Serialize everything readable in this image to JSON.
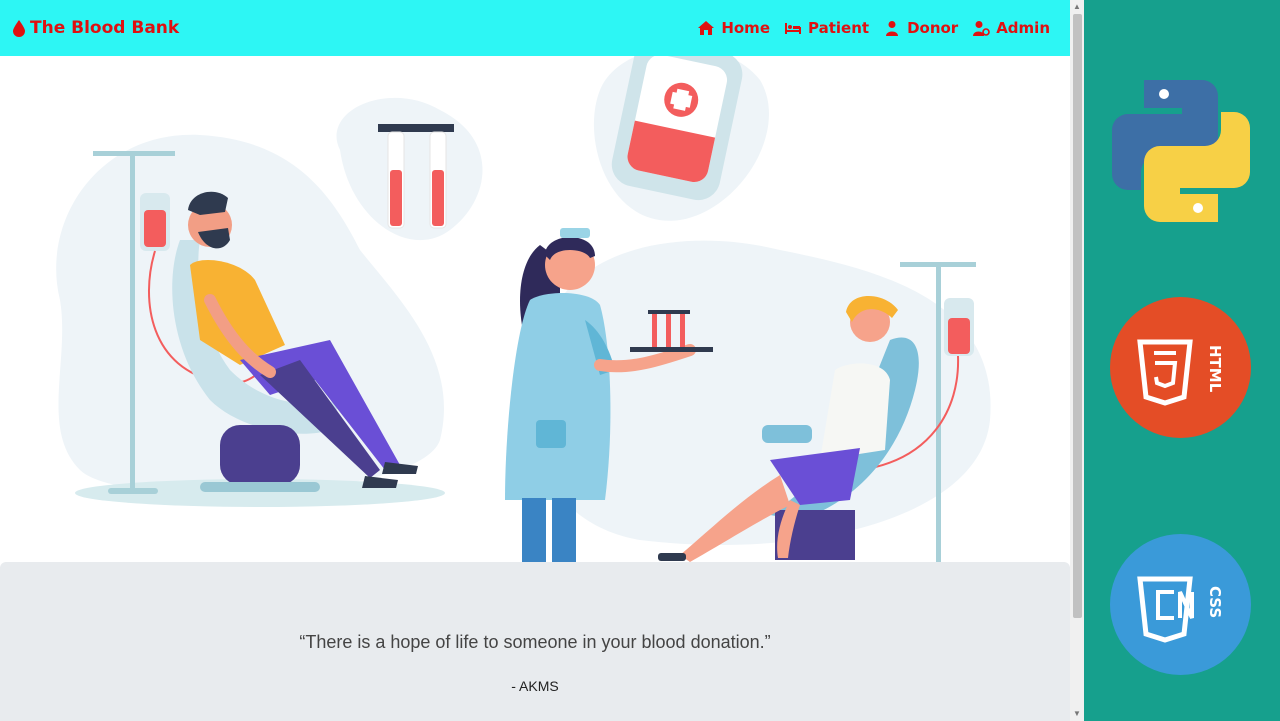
{
  "navbar": {
    "brand": "The Blood Bank",
    "links": [
      {
        "label": "Home",
        "icon": "home-icon"
      },
      {
        "label": "Patient",
        "icon": "bed-icon"
      },
      {
        "label": "Donor",
        "icon": "user-icon"
      },
      {
        "label": "Admin",
        "icon": "user-cog-icon"
      }
    ]
  },
  "quote": {
    "text": "“There is a hope of life to someone in your blood donation.”",
    "author": "- AKMS"
  },
  "side_logos": {
    "html_label": "HTML",
    "css_label": "CSS"
  },
  "colors": {
    "navbar": "#2df6f4",
    "brand": "#e01010",
    "side_panel": "#16a08d",
    "quote_bg": "#e8ebee",
    "html_badge": "#e44d26",
    "css_badge": "#3a9ad9"
  }
}
